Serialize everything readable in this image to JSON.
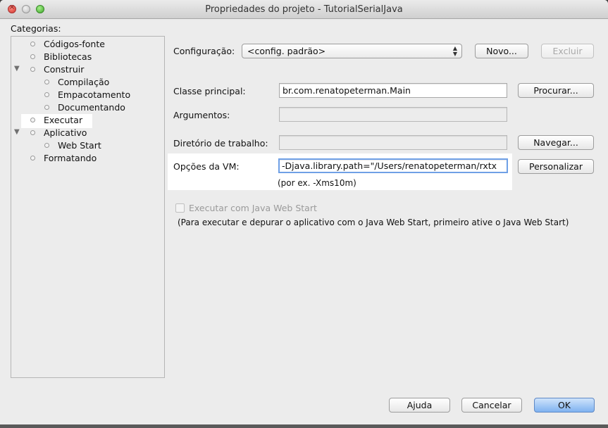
{
  "window": {
    "title": "Propriedades do projeto - TutorialSerialJava"
  },
  "categories": {
    "heading": "Categorias:",
    "items": [
      {
        "label": "Códigos-fonte",
        "level": 0,
        "expandable": false,
        "expanded": false,
        "selected": false
      },
      {
        "label": "Bibliotecas",
        "level": 0,
        "expandable": false,
        "expanded": false,
        "selected": false
      },
      {
        "label": "Construir",
        "level": 0,
        "expandable": true,
        "expanded": true,
        "selected": false
      },
      {
        "label": "Compilação",
        "level": 1,
        "expandable": false,
        "expanded": false,
        "selected": false
      },
      {
        "label": "Empacotamento",
        "level": 1,
        "expandable": false,
        "expanded": false,
        "selected": false
      },
      {
        "label": "Documentando",
        "level": 1,
        "expandable": false,
        "expanded": false,
        "selected": false
      },
      {
        "label": "Executar",
        "level": 0,
        "expandable": false,
        "expanded": false,
        "selected": true
      },
      {
        "label": "Aplicativo",
        "level": 0,
        "expandable": true,
        "expanded": true,
        "selected": false
      },
      {
        "label": "Web Start",
        "level": 1,
        "expandable": false,
        "expanded": false,
        "selected": false
      },
      {
        "label": "Formatando",
        "level": 0,
        "expandable": false,
        "expanded": false,
        "selected": false
      }
    ]
  },
  "configuration": {
    "label": "Configuração:",
    "selected": "<config. padrão>",
    "new_button": "Novo...",
    "delete_button": "Excluir"
  },
  "main_class": {
    "label": "Classe principal:",
    "value": "br.com.renatopeterman.Main",
    "browse_button": "Procurar..."
  },
  "arguments": {
    "label": "Argumentos:",
    "value": ""
  },
  "working_dir": {
    "label": "Diretório de trabalho:",
    "value": "",
    "browse_button": "Navegar..."
  },
  "vm_options": {
    "label": "Opções da VM:",
    "value": "-Djava.library.path=\"/Users/renatopeterman/rxtx",
    "hint": "(por ex. -Xms10m)",
    "customize_button": "Personalizar"
  },
  "web_start": {
    "checkbox_label": "Executar com Java Web Start",
    "checked": false,
    "note": "(Para executar e depurar o aplicativo com o Java Web Start, primeiro ative o Java Web Start)"
  },
  "footer": {
    "help_button": "Ajuda",
    "cancel_button": "Cancelar",
    "ok_button": "OK"
  },
  "icons": {
    "close": "close-icon",
    "minimize": "minimize-icon",
    "maximize": "maximize-icon",
    "tree_bullet": "bullet-icon",
    "tree_arrow": "disclosure-triangle-icon",
    "select_arrows": "updown-arrows-icon"
  },
  "colors": {
    "window_bg": "#ececec",
    "focus_ring": "#6fa0e6",
    "default_button": "#7fb2f0",
    "close_button": "#d0342c",
    "maximize_button": "#3ea52a"
  }
}
